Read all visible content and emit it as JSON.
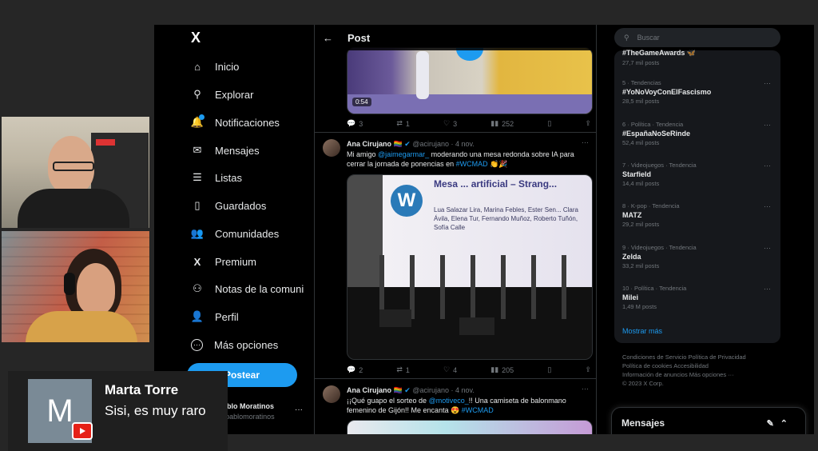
{
  "nav": {
    "logo": "X",
    "items": [
      {
        "label": "Inicio",
        "icon": "home-icon",
        "glyph": "⌂"
      },
      {
        "label": "Explorar",
        "icon": "search-icon",
        "glyph": "⚲"
      },
      {
        "label": "Notificaciones",
        "icon": "bell-icon",
        "glyph": "🔔"
      },
      {
        "label": "Mensajes",
        "icon": "mail-icon",
        "glyph": "✉"
      },
      {
        "label": "Listas",
        "icon": "list-icon",
        "glyph": "☰"
      },
      {
        "label": "Guardados",
        "icon": "bookmark-icon",
        "glyph": "▯"
      },
      {
        "label": "Comunidades",
        "icon": "people-icon",
        "glyph": "👥"
      },
      {
        "label": "Premium",
        "icon": "x-premium-icon",
        "glyph": "X"
      },
      {
        "label": "Notas de la comuni",
        "icon": "notes-icon",
        "glyph": "⚇"
      },
      {
        "label": "Perfil",
        "icon": "person-icon",
        "glyph": "👤"
      },
      {
        "label": "Más opciones",
        "icon": "more-circle-icon",
        "glyph": "⋯"
      }
    ],
    "post_button": "Postear",
    "account_name": "Pablo Moratinos",
    "account_handle": "@pablomoratinos",
    "account_more": "···"
  },
  "feed": {
    "back_glyph": "←",
    "title": "Post",
    "video_time": "0:54",
    "tweet0_actions": {
      "replies": "3",
      "reposts": "1",
      "likes": "3",
      "views": "252"
    },
    "tweet1": {
      "name": "Ana Cirujano",
      "badges": "🏳️‍🌈",
      "handle": "@acirujano",
      "time": "· 4 nov.",
      "text_a": "Mi amigo ",
      "mention": "@jaimegarmar_",
      "text_b": " moderando una mesa redonda sobre IA para cerrar la jornada de ponencias en ",
      "hashtag": "#WCMAD",
      "emoji": " 👏🎉",
      "actions": {
        "replies": "2",
        "reposts": "1",
        "likes": "4",
        "views": "205"
      },
      "slide_title": "Mesa ... artificial – Strang...",
      "slide_names": "Lua Salazar Lira, Marina Febles, Ester Sen... Clara Ávila, Elena Tur, Fernando Muñoz, Roberto Tuñón, Sofía Calle"
    },
    "tweet2": {
      "name": "Ana Cirujano",
      "badges": "🏳️‍🌈",
      "handle": "@acirujano",
      "time": "· 4 nov.",
      "text_a": "¡¡Qué guapo el sorteo de ",
      "mention": "@motiveco_",
      "text_b": "!! Una camiseta de balonmano femenino de Gijón!! Me encanta 😍 ",
      "hashtag": "#WCMAD"
    }
  },
  "right": {
    "search_placeholder": "Buscar",
    "trends": [
      {
        "meta": "",
        "name": "#TheGameAwards 🦋",
        "posts": "27,7 mil posts"
      },
      {
        "meta": "5 · Tendencias",
        "name": "#YoNoVoyConElFascismo",
        "posts": "28,5 mil posts"
      },
      {
        "meta": "6 · Política · Tendencia",
        "name": "#EspañaNoSeRinde",
        "posts": "52,4 mil posts"
      },
      {
        "meta": "7 · Videojuegos · Tendencia",
        "name": "Starfield",
        "posts": "14,4 mil posts"
      },
      {
        "meta": "8 · K-pop · Tendencia",
        "name": "MATZ",
        "posts": "29,2 mil posts"
      },
      {
        "meta": "9 · Videojuegos · Tendencia",
        "name": "Zelda",
        "posts": "33,2 mil posts"
      },
      {
        "meta": "10 · Política · Tendencia",
        "name": "Milei",
        "posts": "1,49 M posts"
      }
    ],
    "show_more": "Mostrar más",
    "footer_lines": [
      "Condiciones de Servicio   Política de Privacidad",
      "Política de cookies   Accesibilidad",
      "Información de anuncios   Más opciones ···",
      "© 2023 X Corp."
    ],
    "messages_title": "Mensajes"
  },
  "chat": {
    "initial": "M",
    "name": "Marta Torre",
    "message": "Sisi, es muy raro"
  },
  "colors": {
    "accent": "#1d9bf0",
    "youtube": "#e62117"
  }
}
